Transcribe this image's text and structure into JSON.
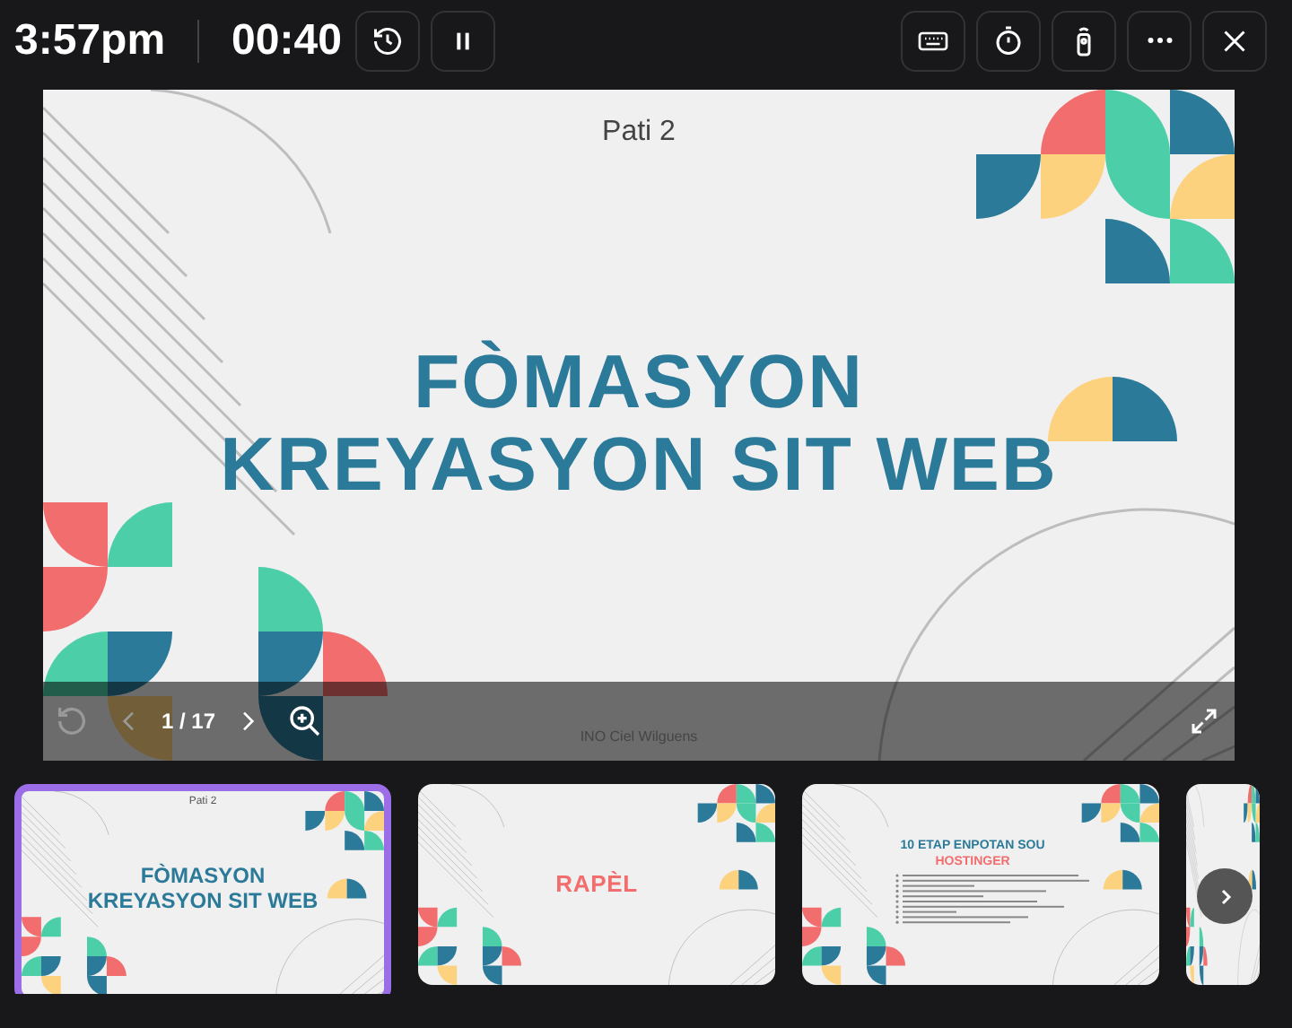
{
  "top_bar": {
    "clock": "3:57pm",
    "timer": "00:40"
  },
  "slide": {
    "subtitle": "Pati 2",
    "title_lines": [
      "FÒMASYON",
      "KREYASYON SIT WEB"
    ],
    "footer": "INO Ciel Wilguens"
  },
  "slide_controls": {
    "page": "1 / 17"
  },
  "thumbnails": [
    {
      "kind": "title",
      "selected": true,
      "subtitle": "Pati 2",
      "title_lines": [
        "FÒMASYON",
        "KREYASYON SIT WEB"
      ]
    },
    {
      "kind": "heading",
      "selected": false,
      "title": "RAPÈL"
    },
    {
      "kind": "list",
      "selected": false,
      "title_lines": [
        "10 ETAP ENPOTAN SOU",
        "HOSTINGER"
      ]
    },
    {
      "kind": "partial",
      "selected": false
    }
  ]
}
